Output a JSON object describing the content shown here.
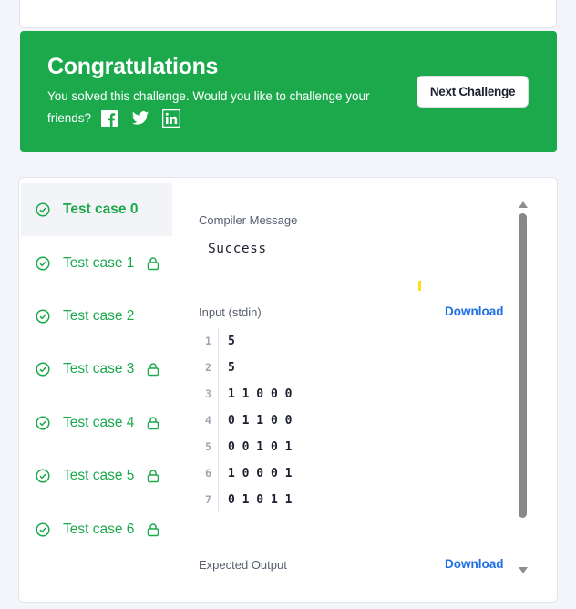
{
  "banner": {
    "title": "Congratulations",
    "message": "You solved this challenge. Would you like to challenge your friends?",
    "next_button": "Next Challenge",
    "social_icons": [
      "facebook-icon",
      "twitter-icon",
      "linkedin-icon"
    ],
    "bg_color": "#1ba94c"
  },
  "test_cases": [
    {
      "label": "Test case 0",
      "locked": false,
      "active": true
    },
    {
      "label": "Test case 1",
      "locked": true,
      "active": false
    },
    {
      "label": "Test case 2",
      "locked": false,
      "active": false
    },
    {
      "label": "Test case 3",
      "locked": true,
      "active": false
    },
    {
      "label": "Test case 4",
      "locked": true,
      "active": false
    },
    {
      "label": "Test case 5",
      "locked": true,
      "active": false
    },
    {
      "label": "Test case 6",
      "locked": true,
      "active": false
    }
  ],
  "detail": {
    "compiler_label": "Compiler Message",
    "compiler_message": "Success",
    "input_label": "Input (stdin)",
    "input_download": "Download",
    "input_lines": [
      {
        "n": "1",
        "text": "5"
      },
      {
        "n": "2",
        "text": "5"
      },
      {
        "n": "3",
        "text": "1 1 0 0 0"
      },
      {
        "n": "4",
        "text": "0 1 1 0 0"
      },
      {
        "n": "5",
        "text": "0 0 1 0 1"
      },
      {
        "n": "6",
        "text": "1 0 0 0 1"
      },
      {
        "n": "7",
        "text": "0 1 0 1 1"
      }
    ],
    "expected_label": "Expected Output",
    "expected_download": "Download"
  },
  "colors": {
    "success": "#1ba94c",
    "link": "#1f6fe5"
  }
}
